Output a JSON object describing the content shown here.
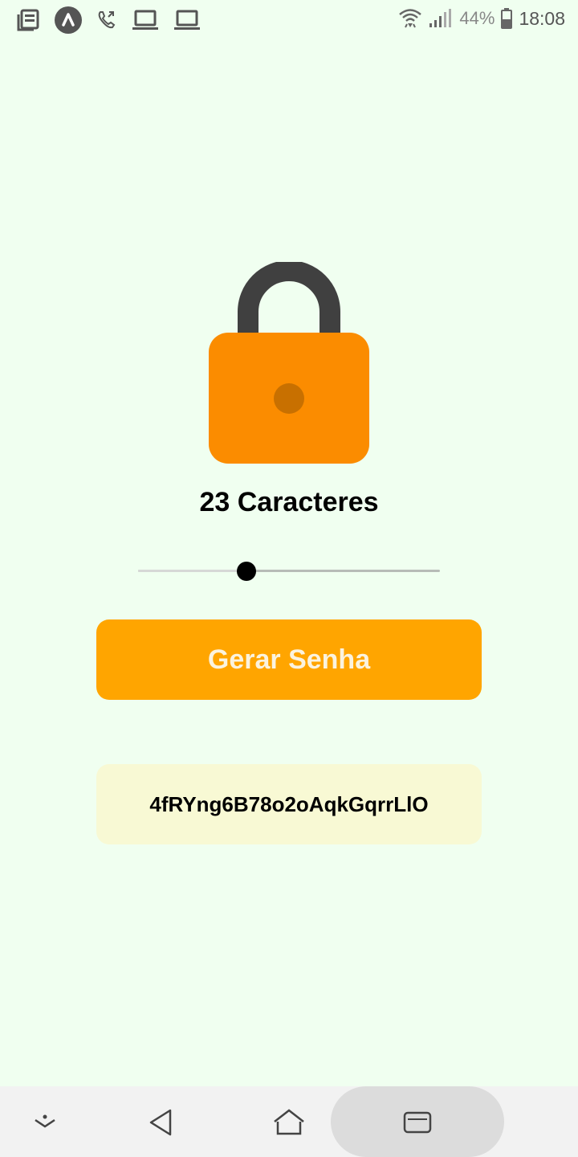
{
  "status_bar": {
    "battery_percent": "44%",
    "time": "18:08",
    "left_icons": [
      "news-icon",
      "app-icon",
      "call-icon",
      "laptop-icon",
      "laptop-icon"
    ],
    "right_icons": [
      "wifi-icon",
      "signal-icon",
      "battery-icon"
    ]
  },
  "lock": {
    "icon": "padlock-icon",
    "body_color": "#fb8c00",
    "shackle_color": "#404040",
    "keyhole_color": "#c87000"
  },
  "length_label": "23 Caracteres",
  "slider": {
    "value_fraction": 0.36
  },
  "generate_button": {
    "label": "Gerar Senha",
    "color": "#ffa500"
  },
  "password": {
    "value": "4fRYng6B78o2oAqkGqrrLlO",
    "background": "#f8f9d4"
  },
  "nav_bar": {
    "items": [
      "dropdown-icon",
      "back-icon",
      "home-icon",
      "recents-icon"
    ]
  },
  "colors": {
    "background": "#f0fff0"
  }
}
